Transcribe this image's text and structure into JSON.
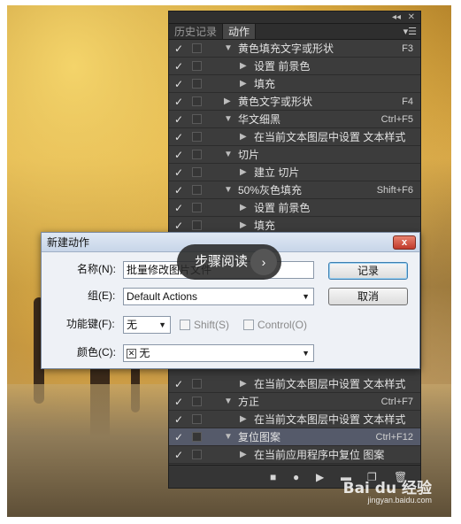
{
  "panel": {
    "tabs": [
      {
        "label": "历史记录"
      },
      {
        "label": "动作"
      }
    ],
    "rows": [
      {
        "label": "黄色填充文字或形状",
        "key": "F3",
        "level": 0,
        "expanded": true
      },
      {
        "label": "设置 前景色",
        "key": "",
        "level": 1,
        "expanded": false
      },
      {
        "label": "填充",
        "key": "",
        "level": 1,
        "expanded": false
      },
      {
        "label": "黄色文字或形状",
        "key": "F4",
        "level": 0,
        "expanded": false
      },
      {
        "label": "华文细黑",
        "key": "Ctrl+F5",
        "level": 0,
        "expanded": true
      },
      {
        "label": "在当前文本图层中设置 文本样式",
        "key": "",
        "level": 1,
        "expanded": false
      },
      {
        "label": "切片",
        "key": "",
        "level": 0,
        "expanded": true
      },
      {
        "label": "建立 切片",
        "key": "",
        "level": 1,
        "expanded": false
      },
      {
        "label": "50%灰色填充",
        "key": "Shift+F6",
        "level": 0,
        "expanded": true
      },
      {
        "label": "设置 前景色",
        "key": "",
        "level": 1,
        "expanded": false
      },
      {
        "label": "填充",
        "key": "",
        "level": 1,
        "expanded": false
      }
    ],
    "rows_lower": [
      {
        "label": "在当前文本图层中设置 文本样式",
        "key": "",
        "level": 1,
        "expanded": false
      },
      {
        "label": "方正",
        "key": "Ctrl+F7",
        "level": 0,
        "expanded": true
      },
      {
        "label": "在当前文本图层中设置 文本样式",
        "key": "",
        "level": 1,
        "expanded": false
      },
      {
        "label": "复位图案",
        "key": "Ctrl+F12",
        "level": 0,
        "expanded": true,
        "selected": true
      },
      {
        "label": "在当前应用程序中复位 图案",
        "key": "",
        "level": 1,
        "expanded": false
      }
    ],
    "check_glyph": "✓",
    "colors": {
      "bg": "#3b3b3b",
      "selected": "#555a6a"
    }
  },
  "dialog": {
    "title": "新建动作",
    "close_label": "x",
    "name_label": "名称(N):",
    "name_value": "批量修改图片文件",
    "set_label": "组(E):",
    "set_value": "Default Actions",
    "fkey_label": "功能键(F):",
    "fkey_value": "无",
    "shift_label": "Shift(S)",
    "control_label": "Control(O)",
    "color_label": "颜色(C):",
    "color_value": "无",
    "record_label": "记录",
    "cancel_label": "取消"
  },
  "overlay": {
    "text": "步骤阅读",
    "arrow": "›"
  },
  "watermark": {
    "logo": "Bai du 经验",
    "url": "jingyan.baidu.com"
  }
}
